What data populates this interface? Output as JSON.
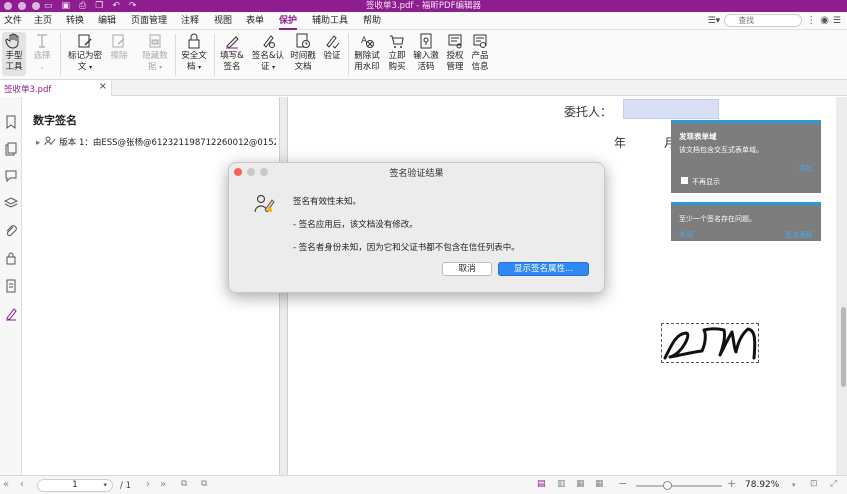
{
  "window": {
    "title": "签收单3.pdf - 福昕PDF编辑器"
  },
  "menu": {
    "items": [
      "文件",
      "主页",
      "转换",
      "编辑",
      "页面管理",
      "注释",
      "视图",
      "表单",
      "保护",
      "辅助工具",
      "帮助"
    ],
    "active": "保护",
    "search_placeholder": "查找"
  },
  "toolbar": {
    "hand": [
      "手型",
      "工具"
    ],
    "select": [
      "选择"
    ],
    "mark_redact": [
      "标记为密",
      "文"
    ],
    "erase": [
      "擦除"
    ],
    "hide_data": [
      "隐藏数",
      "据"
    ],
    "security_doc": [
      "安全文",
      "档"
    ],
    "fill_sign": [
      "填写&",
      "签名"
    ],
    "sign_cert": [
      "签名&认",
      "证"
    ],
    "timestamp": [
      "时间戳",
      "文档"
    ],
    "verify": [
      "验证"
    ],
    "remove_watermark": [
      "删除试",
      "用水印"
    ],
    "buy_now": [
      "立即",
      "购买"
    ],
    "activation": [
      "输入激",
      "活码"
    ],
    "license": [
      "授权",
      "管理"
    ],
    "product_info": [
      "产品",
      "信息"
    ]
  },
  "tab": {
    "filename": "签收单3.pdf",
    "close": "×"
  },
  "panel": {
    "title": "数字签名",
    "signature_row": "版本 1：由ESS@张杨@612321198712260012@0152..."
  },
  "document": {
    "principal_label": "委托人：",
    "year": "年",
    "month": "月"
  },
  "notifications": {
    "form_title": "发现表单域",
    "form_desc": "该文档包含交互式表单域。",
    "form_link": "突出",
    "form_checkbox": "不再显示",
    "sig_desc": "至少一个签名存在问题。",
    "sig_link_left": "关闭",
    "sig_link_right": "签名面板"
  },
  "dialog": {
    "title": "签名验证结果",
    "line1": "签名有效性未知。",
    "line2": "- 签名应用后，该文档没有修改。",
    "line3": "- 签名者身份未知，因为它和父证书都不包含在信任列表中。",
    "cancel": "取消",
    "show_props": "显示签名属性..."
  },
  "statusbar": {
    "current_page": "1",
    "total_pages": "/ 1",
    "zoom": "78.92%",
    "zoom_level": 0.37
  },
  "colors": {
    "brand": "#8e1d8f",
    "accent": "#2f88f5",
    "field_fill": "#d8dff7",
    "arrow": "#e8413a"
  }
}
